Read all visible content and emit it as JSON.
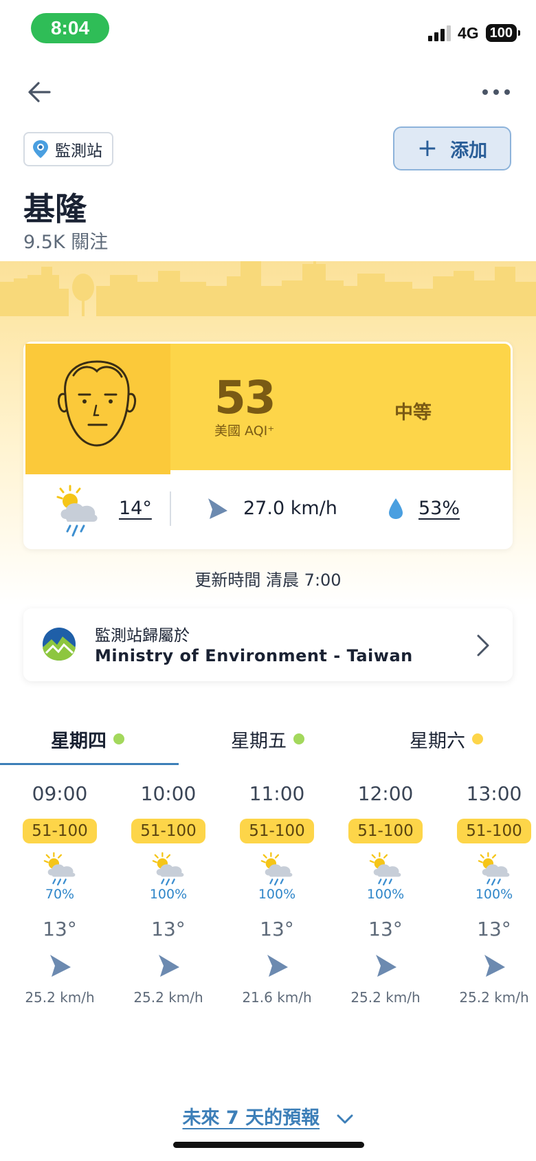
{
  "status_bar": {
    "time": "8:04",
    "network": "4G",
    "battery": "100"
  },
  "header": {
    "station_chip": "監測站",
    "add_button": "添加",
    "city": "基隆",
    "followers": "9.5K 關注"
  },
  "aqi": {
    "value": "53",
    "label": "美國 AQI⁺",
    "level": "中等",
    "level_color": "#fdd549",
    "weather_icon": "partly-sunny-rain-icon",
    "temperature": "14°",
    "wind": "27.0 km/h",
    "humidity": "53%"
  },
  "updated": "更新時間 清晨 7:00",
  "ministry": {
    "caption": "監測站歸屬於",
    "name": "Ministry of Environment - Taiwan"
  },
  "tabs": [
    {
      "label": "星期四",
      "dot_color": "#a3d85c",
      "active": true
    },
    {
      "label": "星期五",
      "dot_color": "#a3d85c",
      "active": false
    },
    {
      "label": "星期六",
      "dot_color": "#fdd549",
      "active": false
    }
  ],
  "hourly": [
    {
      "time": "09:00",
      "aqi": "51-100",
      "rain": "70%",
      "temp": "13°",
      "wind": "25.2 km/h"
    },
    {
      "time": "10:00",
      "aqi": "51-100",
      "rain": "100%",
      "temp": "13°",
      "wind": "25.2 km/h"
    },
    {
      "time": "11:00",
      "aqi": "51-100",
      "rain": "100%",
      "temp": "13°",
      "wind": "21.6 km/h"
    },
    {
      "time": "12:00",
      "aqi": "51-100",
      "rain": "100%",
      "temp": "13°",
      "wind": "25.2 km/h"
    },
    {
      "time": "13:00",
      "aqi": "51-100",
      "rain": "100%",
      "temp": "13°",
      "wind": "25.2 km/h"
    }
  ],
  "forecast_link": "未來 7 天的預報"
}
